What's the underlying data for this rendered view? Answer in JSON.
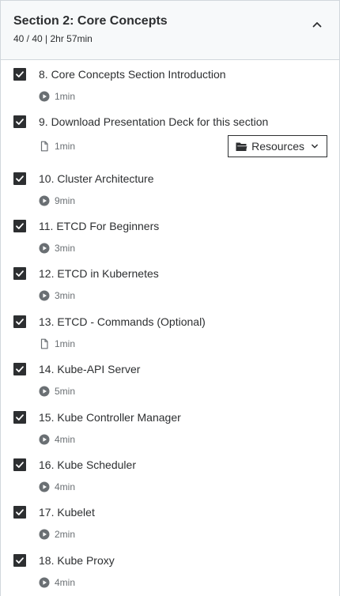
{
  "section": {
    "title": "Section 2: Core Concepts",
    "meta": "40 / 40 | 2hr 57min"
  },
  "items": [
    {
      "title": "8. Core Concepts Section Introduction",
      "duration": "1min",
      "type": "video",
      "completed": true
    },
    {
      "title": "9. Download Presentation Deck for this section",
      "duration": "1min",
      "type": "article",
      "completed": true,
      "resources_label": "Resources"
    },
    {
      "title": "10. Cluster Architecture",
      "duration": "9min",
      "type": "video",
      "completed": true
    },
    {
      "title": "11. ETCD For Beginners",
      "duration": "3min",
      "type": "video",
      "completed": true
    },
    {
      "title": "12. ETCD in Kubernetes",
      "duration": "3min",
      "type": "video",
      "completed": true
    },
    {
      "title": "13. ETCD - Commands (Optional)",
      "duration": "1min",
      "type": "article",
      "completed": true
    },
    {
      "title": "14. Kube-API Server",
      "duration": "5min",
      "type": "video",
      "completed": true
    },
    {
      "title": "15. Kube Controller Manager",
      "duration": "4min",
      "type": "video",
      "completed": true
    },
    {
      "title": "16. Kube Scheduler",
      "duration": "4min",
      "type": "video",
      "completed": true
    },
    {
      "title": "17. Kubelet",
      "duration": "2min",
      "type": "video",
      "completed": true
    },
    {
      "title": "18. Kube Proxy",
      "duration": "4min",
      "type": "video",
      "completed": true
    }
  ]
}
